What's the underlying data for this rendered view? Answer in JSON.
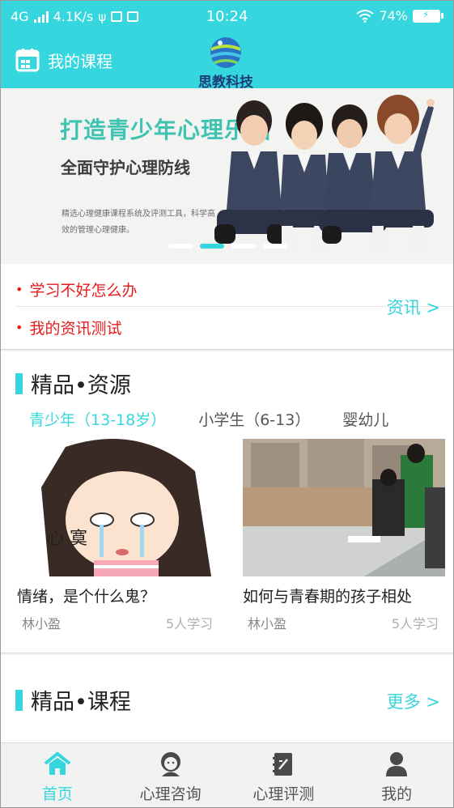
{
  "status_bar": {
    "network": "4G",
    "speed": "4.1K/s",
    "time": "10:24",
    "battery": "74%"
  },
  "header": {
    "my_courses": "我的课程",
    "logo_text": "思教科技"
  },
  "banner": {
    "title": "打造青少年心理乐园",
    "subtitle": "全面守护心理防线",
    "description": "精选心理健康课程系统及评测工具，科学高效的管理心理健康。",
    "active_slide": 2,
    "slide_count": 4
  },
  "news": {
    "items": [
      "学习不好怎么办",
      "我的资讯测试"
    ],
    "more": "资讯 >"
  },
  "resources": {
    "title": "精品•资源",
    "tabs": [
      "青少年（13-18岁）",
      "小学生（6-13）",
      "婴幼儿"
    ],
    "active_tab": 0,
    "cards": [
      {
        "title": "情绪，是个什么鬼？",
        "author": "林小盈",
        "count": "5人学习",
        "image_text": "心 寞"
      },
      {
        "title": "如何与青春期的孩子相处",
        "author": "林小盈",
        "count": "5人学习"
      }
    ]
  },
  "courses": {
    "title": "精品•课程",
    "more": "更多 >"
  },
  "tabbar": {
    "items": [
      {
        "label": "首页",
        "icon": "home-icon"
      },
      {
        "label": "心理咨询",
        "icon": "counselor-icon"
      },
      {
        "label": "心理评测",
        "icon": "assessment-icon"
      },
      {
        "label": "我的",
        "icon": "profile-icon"
      }
    ],
    "active": 0
  },
  "colors": {
    "accent": "#35d6dd",
    "news_red": "#e81b1b",
    "logo_blue": "#1c3f7a"
  }
}
